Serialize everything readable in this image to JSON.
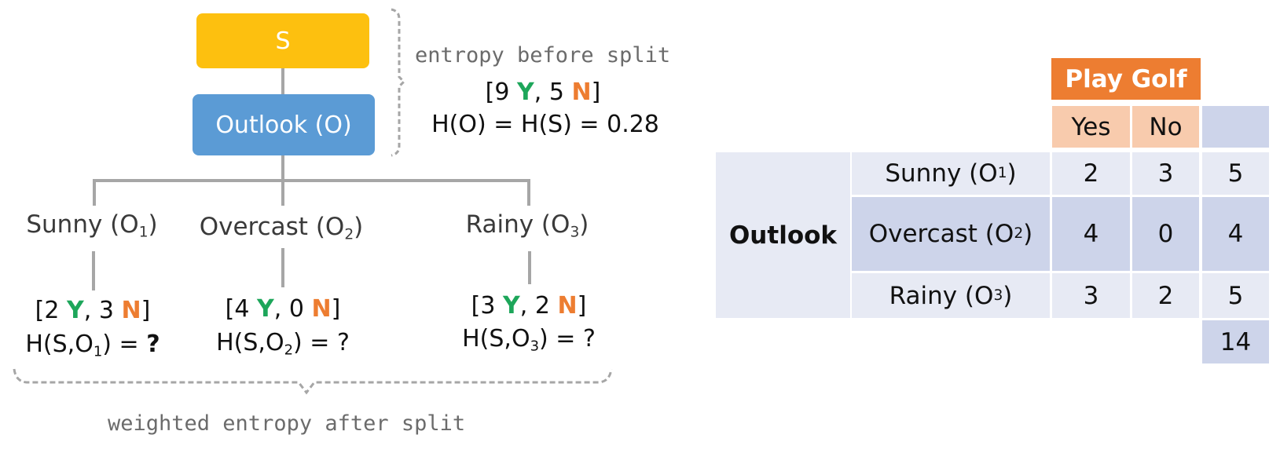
{
  "tree": {
    "root_label": "S",
    "split_label": "Outlook (O)",
    "before": {
      "caption": "entropy before split",
      "counts": {
        "open": "[",
        "yes_n": "9",
        "yes": "Y",
        "sep": ",",
        "no_n": "5",
        "no": "N",
        "close": "]"
      },
      "formula": "H(O) = H(S) = 0.28"
    },
    "branches": [
      {
        "name": "Sunny",
        "sub": "1",
        "yes_n": "2",
        "no_n": "3",
        "entropy_prefix": "H(S,O",
        "entropy_suffix": ") = ",
        "entropy_value": "?",
        "bold_value": true
      },
      {
        "name": "Overcast",
        "sub": "2",
        "yes_n": "4",
        "no_n": "0",
        "entropy_prefix": "H(S,O",
        "entropy_suffix": ") = ",
        "entropy_value": "?",
        "bold_value": false
      },
      {
        "name": "Rainy",
        "sub": "3",
        "yes_n": "3",
        "no_n": "2",
        "entropy_prefix": "H(S,O",
        "entropy_suffix": ") = ",
        "entropy_value": "?",
        "bold_value": false
      }
    ],
    "after_caption": "weighted entropy after split",
    "yes_symbol": "Y",
    "no_symbol": "N"
  },
  "table": {
    "header": "Play Golf",
    "columns": [
      "Yes",
      "No"
    ],
    "row_group": "Outlook",
    "rows": [
      {
        "label": "Sunny",
        "sub": "1",
        "yes": "2",
        "no": "3",
        "total": "5"
      },
      {
        "label": "Overcast",
        "sub": "2",
        "yes": "4",
        "no": "0",
        "total": "4"
      },
      {
        "label": "Rainy",
        "sub": "3",
        "yes": "3",
        "no": "2",
        "total": "5"
      }
    ],
    "grand_total": "14"
  },
  "colors": {
    "root": "#FDC00F",
    "split": "#5B9BD5",
    "yes": "#1DA65A",
    "no": "#ED7D31",
    "header": "#ED7D31",
    "subheader": "#F8CBAD",
    "cell_light": "#E7EAF4",
    "cell_mid": "#CDD4EA"
  }
}
